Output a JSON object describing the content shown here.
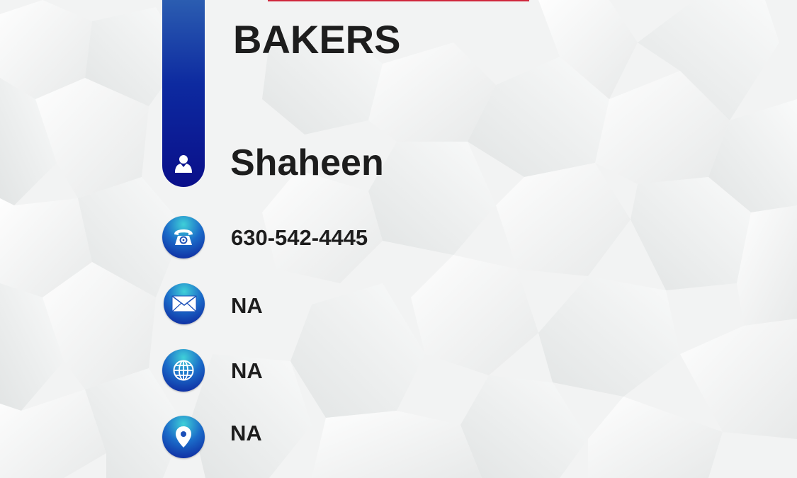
{
  "card": {
    "business_name": "BAKERS",
    "contact_name": "Shaheen",
    "accent_color": "#0a0f8a",
    "highlight_color": "#d0273c",
    "rows": [
      {
        "icon": "phone-icon",
        "value": "630-542-4445"
      },
      {
        "icon": "email-icon",
        "value": "NA"
      },
      {
        "icon": "globe-icon",
        "value": "NA"
      },
      {
        "icon": "location-pin-icon",
        "value": "NA"
      }
    ]
  }
}
